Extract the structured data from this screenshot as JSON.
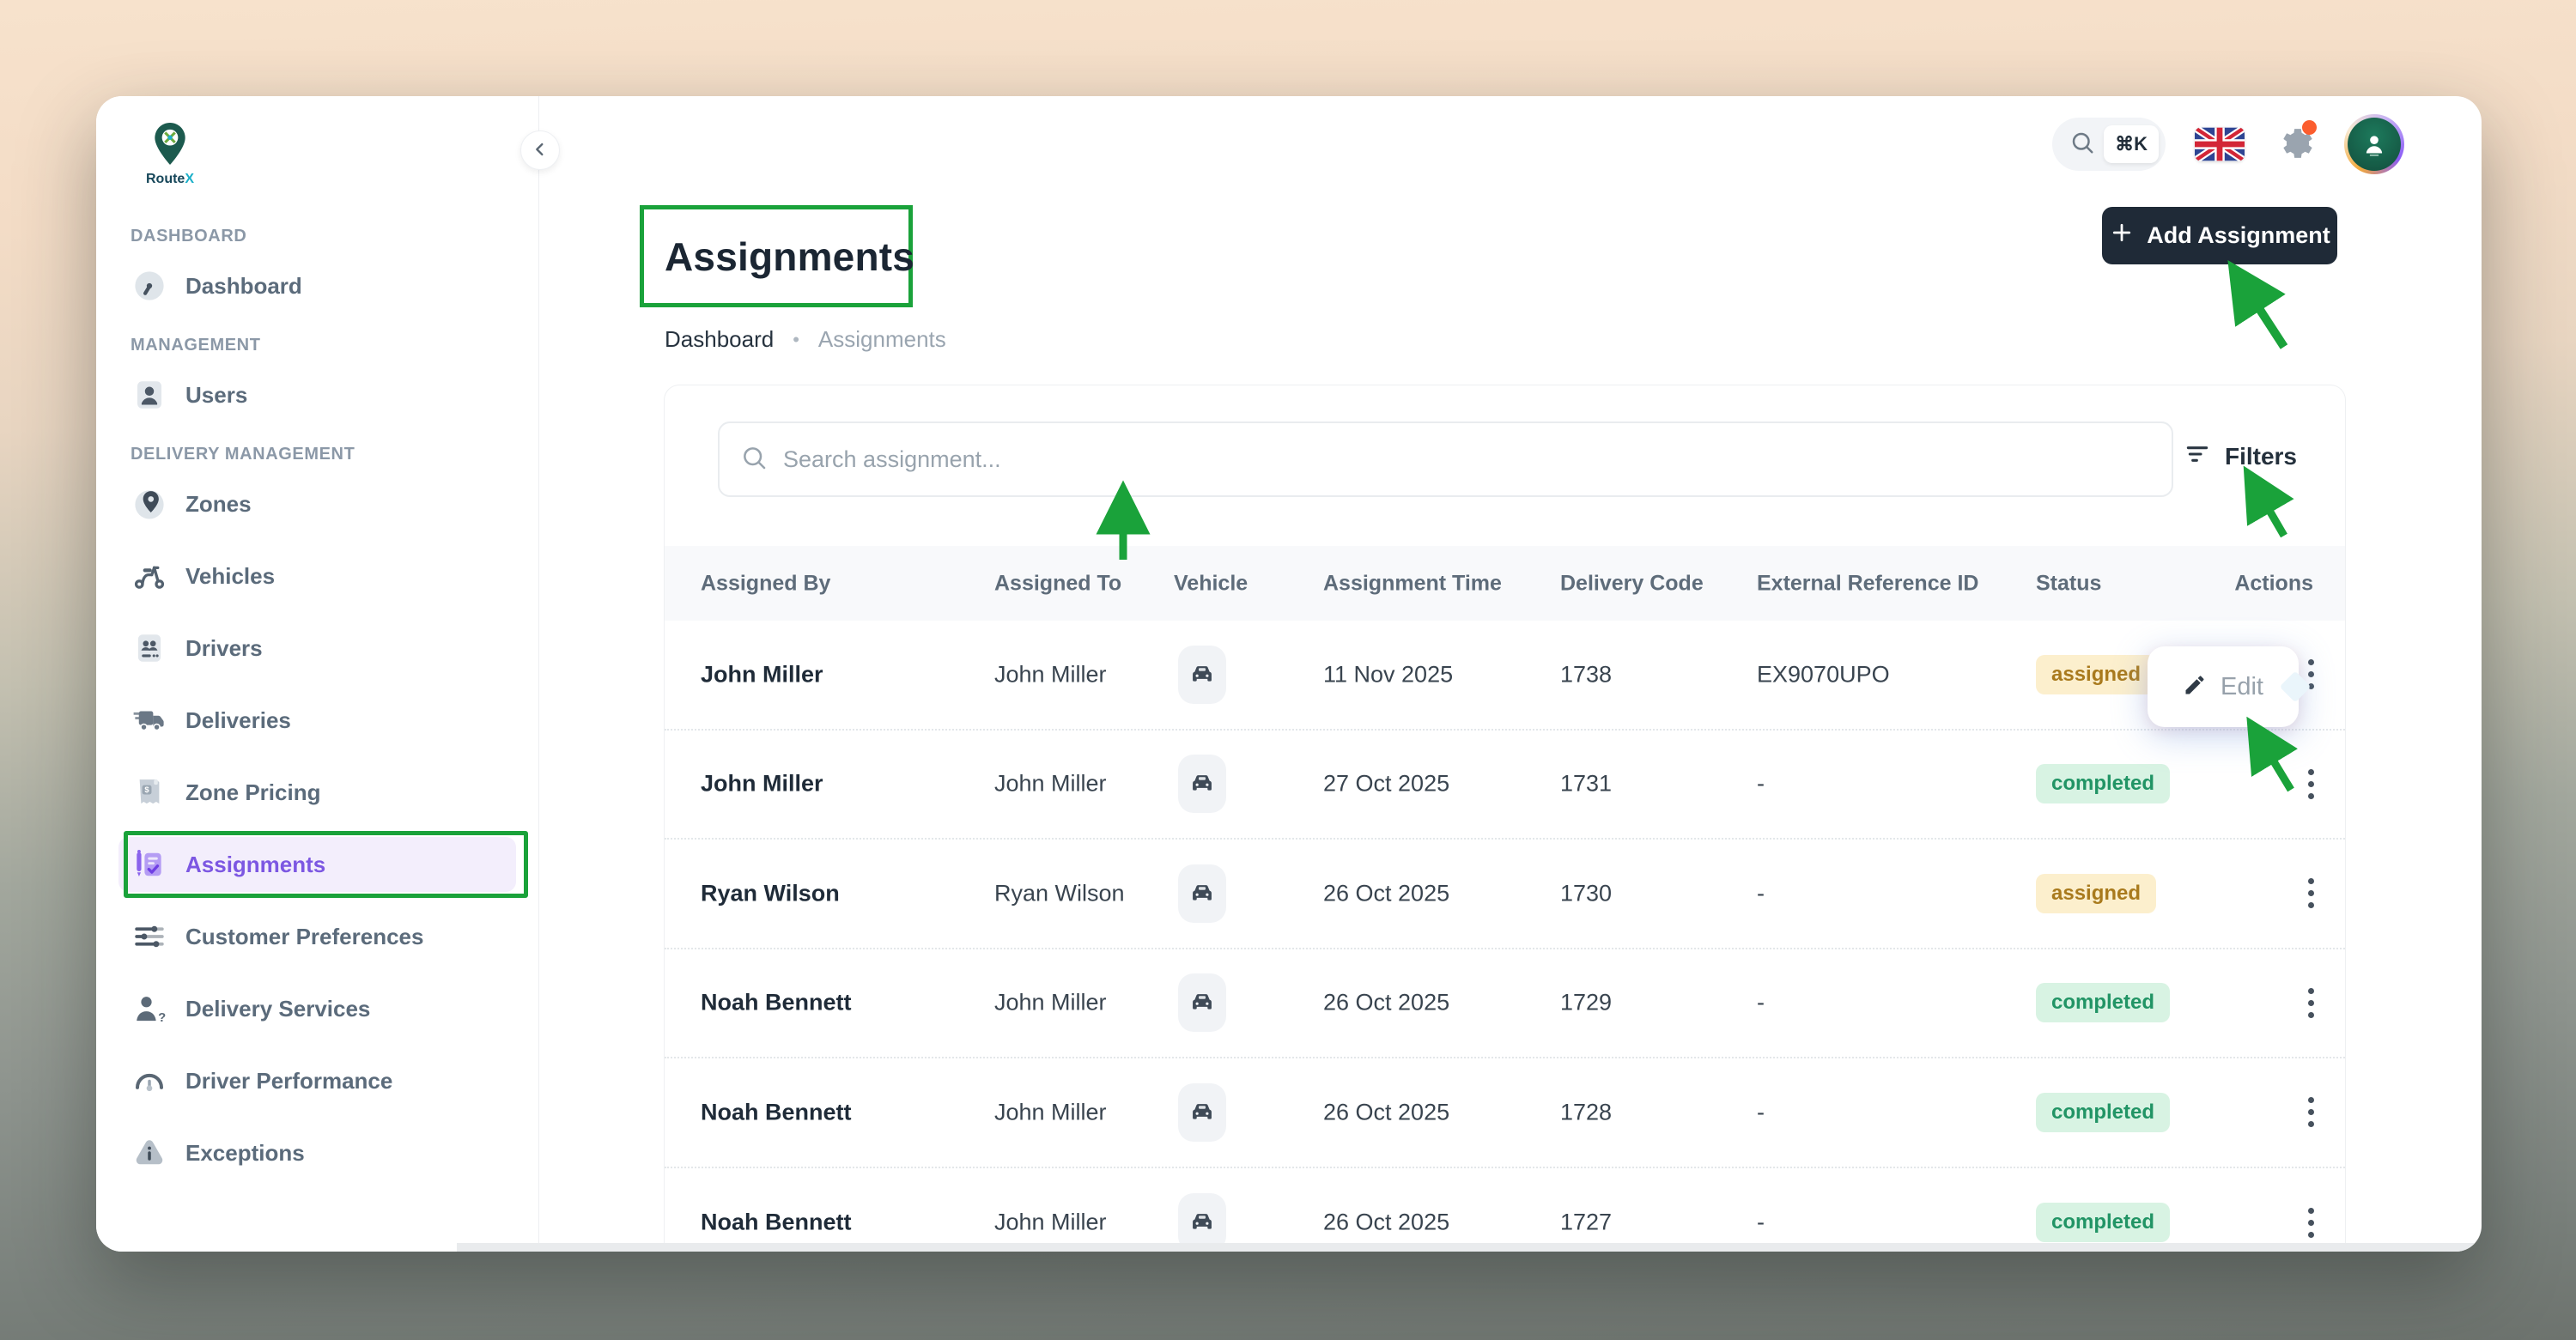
{
  "brand": {
    "name_a": "Route",
    "name_b": "X"
  },
  "topbar": {
    "shortcut_key": "⌘K"
  },
  "sidebar": {
    "sections": [
      {
        "label": "DASHBOARD",
        "items": [
          {
            "label": "Dashboard"
          }
        ]
      },
      {
        "label": "MANAGEMENT",
        "items": [
          {
            "label": "Users"
          }
        ]
      },
      {
        "label": "DELIVERY MANAGEMENT",
        "items": [
          {
            "label": "Zones"
          },
          {
            "label": "Vehicles"
          },
          {
            "label": "Drivers"
          },
          {
            "label": "Deliveries"
          },
          {
            "label": "Zone Pricing"
          },
          {
            "label": "Assignments",
            "active": true
          },
          {
            "label": "Customer Preferences"
          },
          {
            "label": "Delivery Services"
          },
          {
            "label": "Driver Performance"
          },
          {
            "label": "Exceptions"
          }
        ]
      }
    ]
  },
  "page": {
    "title": "Assignments",
    "breadcrumb": {
      "home": "Dashboard",
      "separator": "•",
      "current": "Assignments"
    },
    "add_button_label": "Add Assignment"
  },
  "toolbar": {
    "search_placeholder": "Search assignment...",
    "filters_label": "Filters"
  },
  "table": {
    "columns": [
      "Assigned By",
      "Assigned To",
      "Vehicle",
      "Assignment Time",
      "Delivery Code",
      "External Reference ID",
      "Status",
      "Actions"
    ],
    "edit_action_label": "Edit",
    "rows": [
      {
        "assigned_by": "John Miller",
        "assigned_to": "John Miller",
        "time": "11 Nov 2025",
        "code": "1738",
        "ext": "EX9070UPO",
        "status": "assigned"
      },
      {
        "assigned_by": "John Miller",
        "assigned_to": "John Miller",
        "time": "27 Oct 2025",
        "code": "1731",
        "ext": "-",
        "status": "completed"
      },
      {
        "assigned_by": "Ryan Wilson",
        "assigned_to": "Ryan Wilson",
        "time": "26 Oct 2025",
        "code": "1730",
        "ext": "-",
        "status": "assigned"
      },
      {
        "assigned_by": "Noah Bennett",
        "assigned_to": "John Miller",
        "time": "26 Oct 2025",
        "code": "1729",
        "ext": "-",
        "status": "completed"
      },
      {
        "assigned_by": "Noah Bennett",
        "assigned_to": "John Miller",
        "time": "26 Oct 2025",
        "code": "1728",
        "ext": "-",
        "status": "completed"
      },
      {
        "assigned_by": "Noah Bennett",
        "assigned_to": "John Miller",
        "time": "26 Oct 2025",
        "code": "1727",
        "ext": "-",
        "status": "completed"
      }
    ]
  },
  "colors": {
    "annotation_green": "#1aa23a",
    "active_purple": "#7c57e2",
    "active_purple_bg": "#f3eefc",
    "add_button_bg": "#1f2a37",
    "status_assigned_bg": "#fcefcd",
    "status_assigned_text": "#a97a1d",
    "status_completed_bg": "#d8f3e3",
    "status_completed_text": "#219465",
    "notification_dot": "#fb5d2e"
  }
}
